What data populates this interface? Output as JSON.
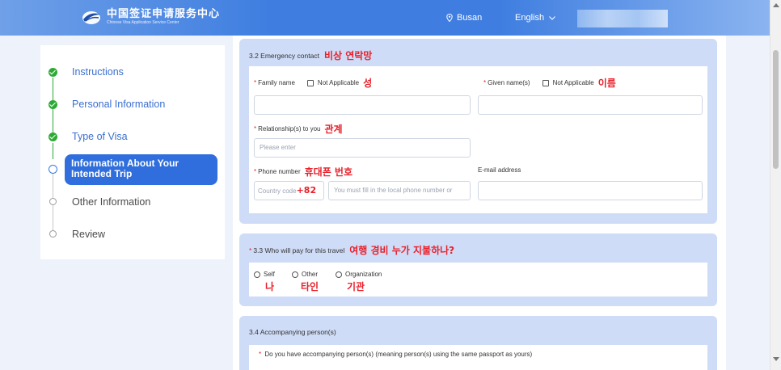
{
  "header": {
    "logo_cn": "中国签证申请服务中心",
    "logo_en": "Chinese Visa Application Service Center",
    "location": "Busan",
    "language": "English"
  },
  "sidebar": {
    "steps": [
      {
        "label": "Instructions",
        "state": "done"
      },
      {
        "label": "Personal Information",
        "state": "done"
      },
      {
        "label": "Type of Visa",
        "state": "done"
      },
      {
        "label": "Information About Your Intended Trip",
        "state": "current"
      },
      {
        "label": "Other Information",
        "state": "todo"
      },
      {
        "label": "Review",
        "state": "todo"
      }
    ]
  },
  "emergency": {
    "title": "3.2 Emergency contact",
    "title_note": "비상 연락망",
    "family_name_label": "Family name",
    "family_na_label": "Not Applicable",
    "family_note": "성",
    "given_name_label": "Given name(s)",
    "given_na_label": "Not Applicable",
    "given_note": "이름",
    "relationship_label": "Relationship(s) to you",
    "relationship_note": "관계",
    "relationship_placeholder": "Please enter",
    "phone_label": "Phone number",
    "phone_note": "휴대폰 번호",
    "country_code_placeholder": "Country code",
    "country_code_note": "+82",
    "local_phone_placeholder": "You must fill in the local phone number or",
    "email_label": "E-mail address"
  },
  "payer": {
    "title": "3.3 Who will pay for this travel",
    "title_note": "여행 경비 누가 지불하나?",
    "options": [
      {
        "label": "Self",
        "note": "나"
      },
      {
        "label": "Other",
        "note": "타인"
      },
      {
        "label": "Organization",
        "note": "기관"
      }
    ]
  },
  "accompany": {
    "title": "3.4 Accompanying person(s)",
    "question": "Do you have accompanying person(s) (meaning person(s) using the same passport as yours)"
  },
  "colors": {
    "header": "#3f7ee0",
    "accent": "#2f6edc",
    "done": "#2daa35",
    "card": "#cfdcf7",
    "annotation": "#e8202a"
  }
}
